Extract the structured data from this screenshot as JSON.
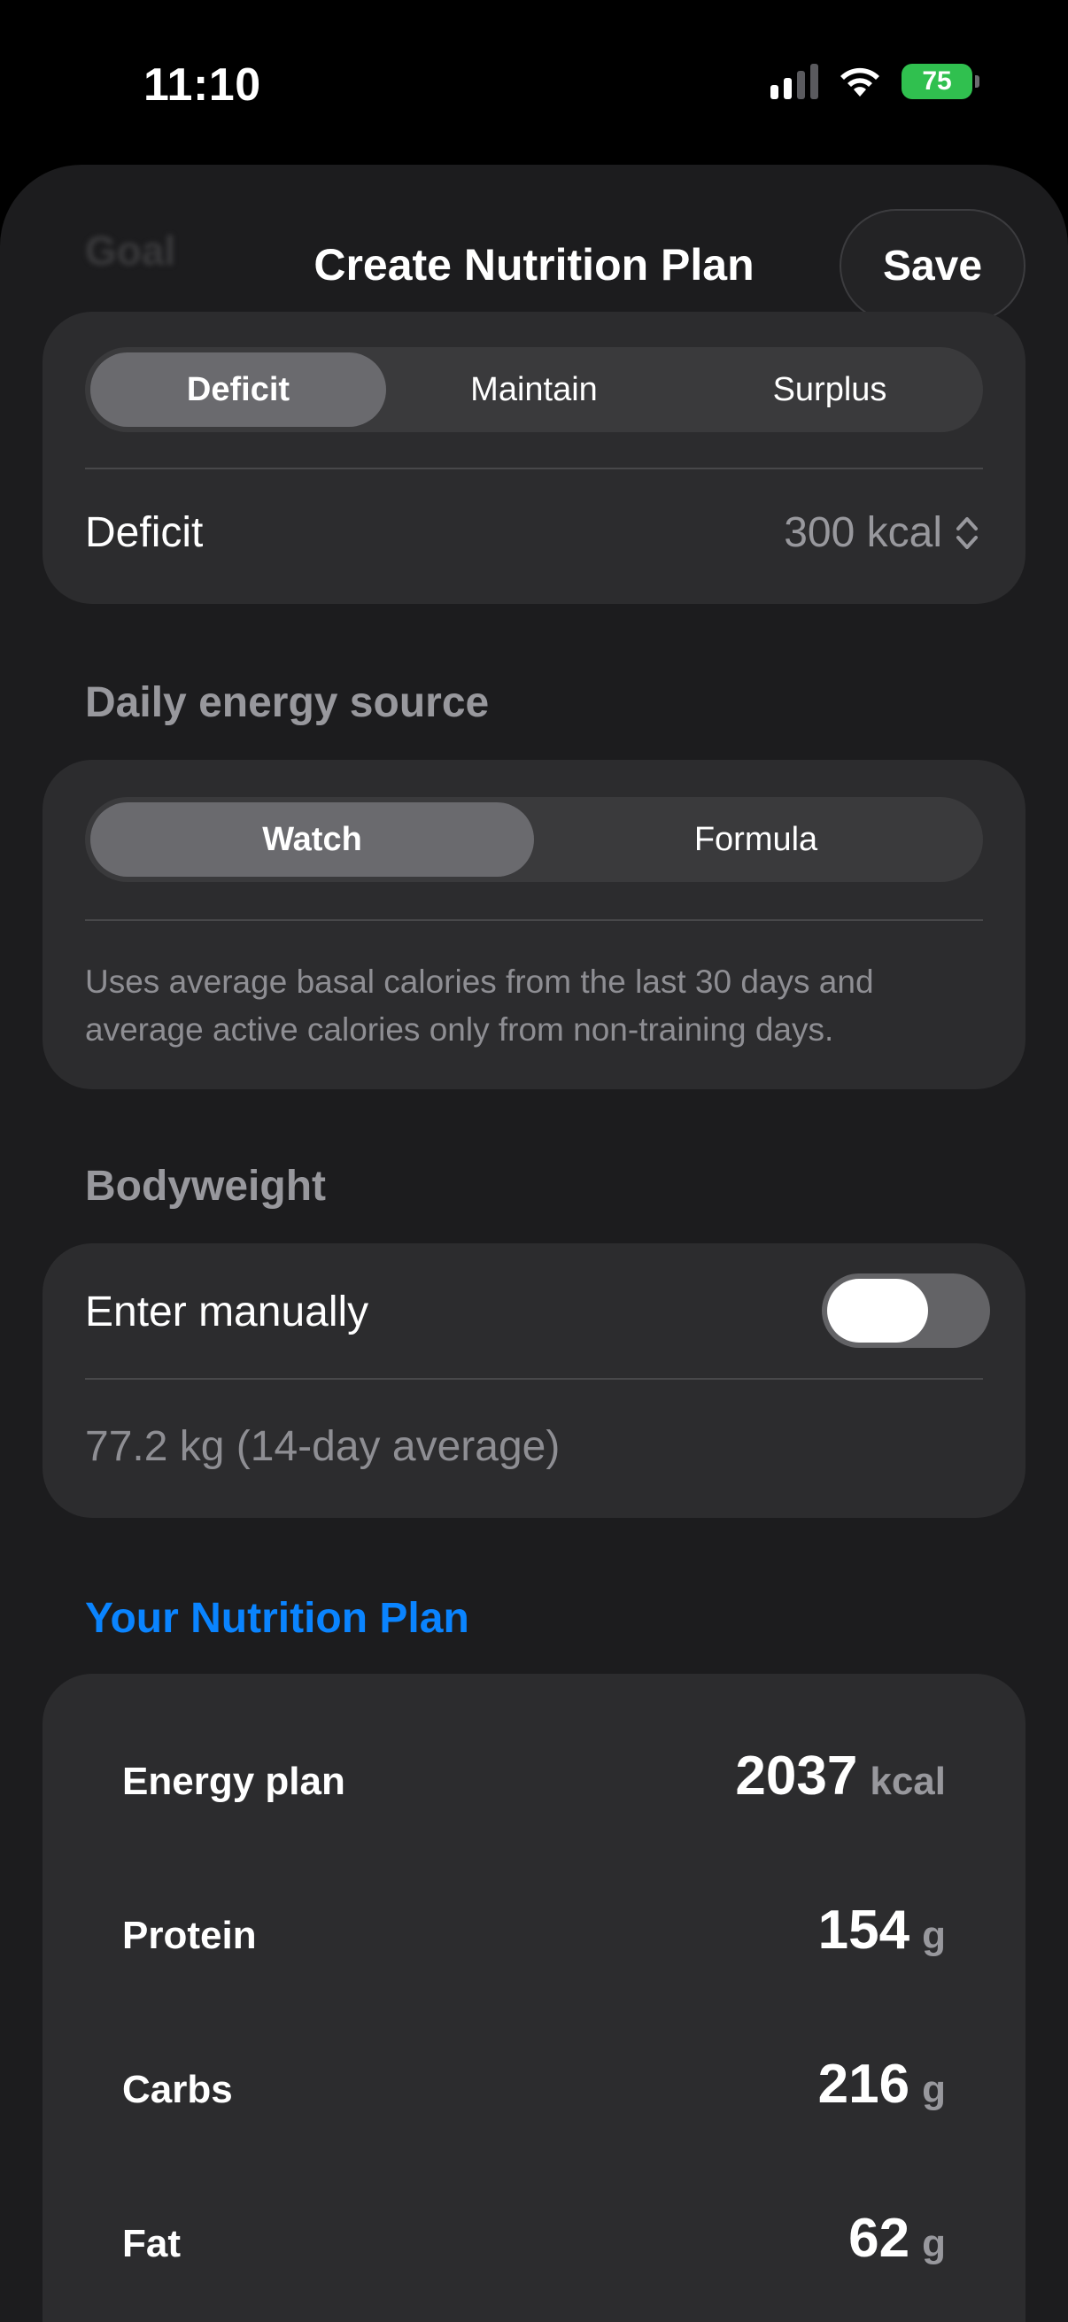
{
  "status_bar": {
    "time": "11:10",
    "battery": "75"
  },
  "nav": {
    "ghost_title": "Goal",
    "title": "Create Nutrition Plan",
    "save_label": "Save"
  },
  "goal": {
    "segments": [
      "Deficit",
      "Maintain",
      "Surplus"
    ],
    "selected": "Deficit",
    "row_label": "Deficit",
    "row_value": "300 kcal"
  },
  "energy_source": {
    "header": "Daily energy source",
    "segments": [
      "Watch",
      "Formula"
    ],
    "selected": "Watch",
    "description": "Uses average basal calories from the last 30 days and average active calories only from non-training days."
  },
  "bodyweight": {
    "header": "Bodyweight",
    "toggle_label": "Enter manually",
    "toggle_on": false,
    "value_text": "77.2 kg (14-day average)"
  },
  "plan": {
    "header": "Your Nutrition Plan",
    "rows": [
      {
        "label": "Energy plan",
        "value": "2037",
        "unit": "kcal"
      },
      {
        "label": "Protein",
        "value": "154",
        "unit": "g"
      },
      {
        "label": "Carbs",
        "value": "216",
        "unit": "g"
      },
      {
        "label": "Fat",
        "value": "62",
        "unit": "g"
      }
    ]
  },
  "colors": {
    "accent": "#0a84ff",
    "battery": "#30c04f",
    "card": "#2c2c2e",
    "sheet": "#1c1c1e"
  }
}
